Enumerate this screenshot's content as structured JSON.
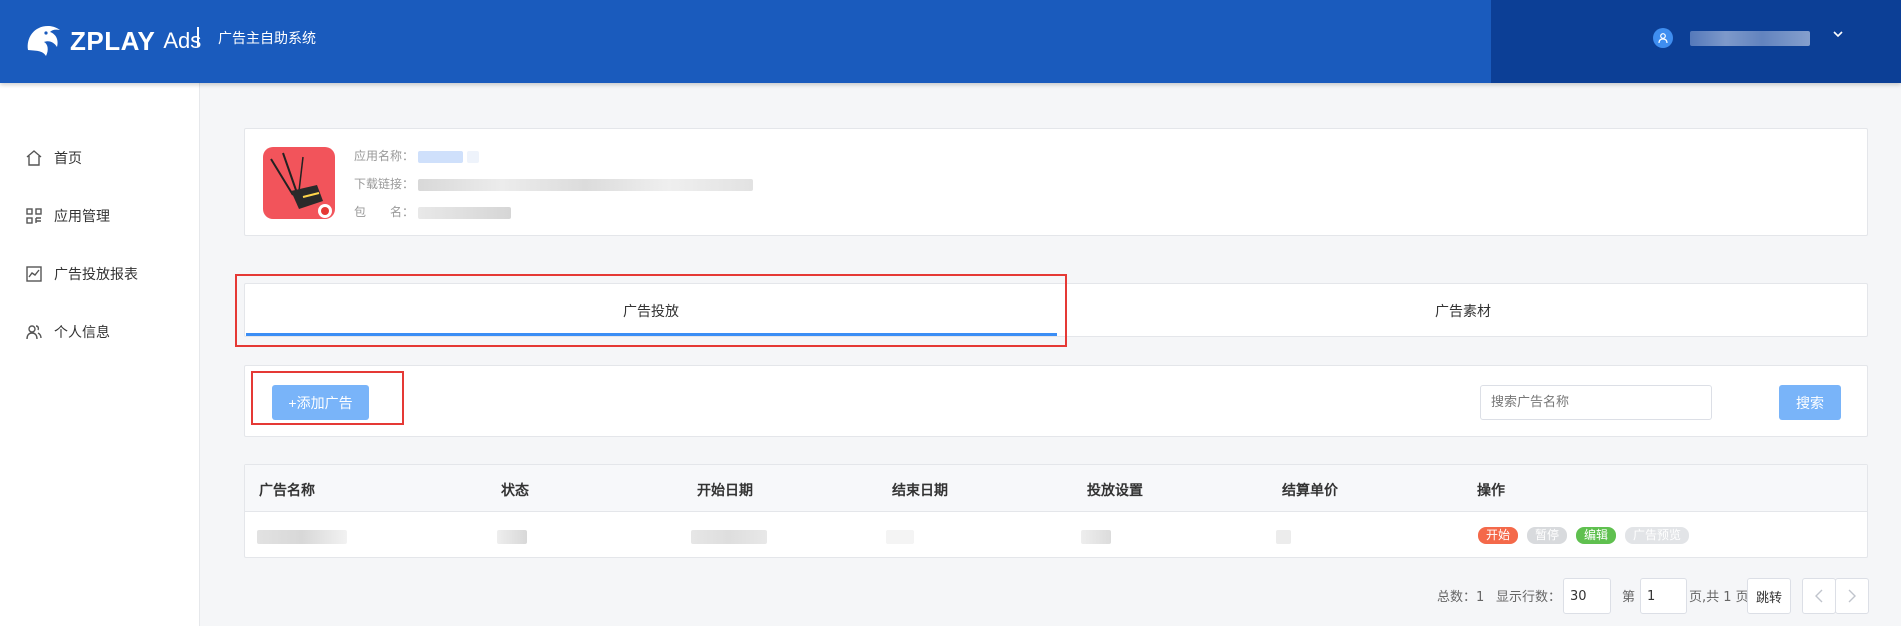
{
  "header": {
    "logo_text": "ZPLAY",
    "logo_sub": "Ads",
    "system_title": "广告主自助系统",
    "user_caret": "⌄"
  },
  "sidebar": {
    "items": [
      {
        "label": "首页",
        "icon": "home-icon"
      },
      {
        "label": "应用管理",
        "icon": "apps-icon"
      },
      {
        "label": "广告投放报表",
        "icon": "report-icon"
      },
      {
        "label": "个人信息",
        "icon": "user-group-icon"
      }
    ]
  },
  "app_info": {
    "name_label": "应用名称：",
    "link_label": "下载链接：",
    "package_label": "包　　名："
  },
  "tabs": [
    {
      "label": "广告投放",
      "active": true
    },
    {
      "label": "广告素材",
      "active": false
    }
  ],
  "toolbar": {
    "add_label": "+添加广告",
    "search_placeholder": "搜索广告名称",
    "search_label": "搜索"
  },
  "table": {
    "columns": [
      "广告名称",
      "状态",
      "开始日期",
      "结束日期",
      "投放设置",
      "结算单价",
      "操作"
    ],
    "actions": [
      {
        "label": "开始",
        "color": "#f4694a"
      },
      {
        "label": "暂停",
        "color": "#d8dadd"
      },
      {
        "label": "编辑",
        "color": "#5fc04f"
      },
      {
        "label": "广告预览",
        "color": "#d8dadd"
      }
    ]
  },
  "pagination": {
    "total_label": "总数：1",
    "rows_label": "显示行数：",
    "rows_value": "30",
    "page_prefix": "第",
    "page_value": "1",
    "page_suffix": "页,共 1 页",
    "jump_label": "跳转",
    "prev": "‹",
    "next": "›"
  },
  "colors": {
    "header_bg": "#1a5bbd",
    "header_right_bg": "#0c3f96",
    "primary_button": "#79b4f9",
    "tab_active": "#3b8ef5",
    "highlight_box": "#e53935"
  }
}
